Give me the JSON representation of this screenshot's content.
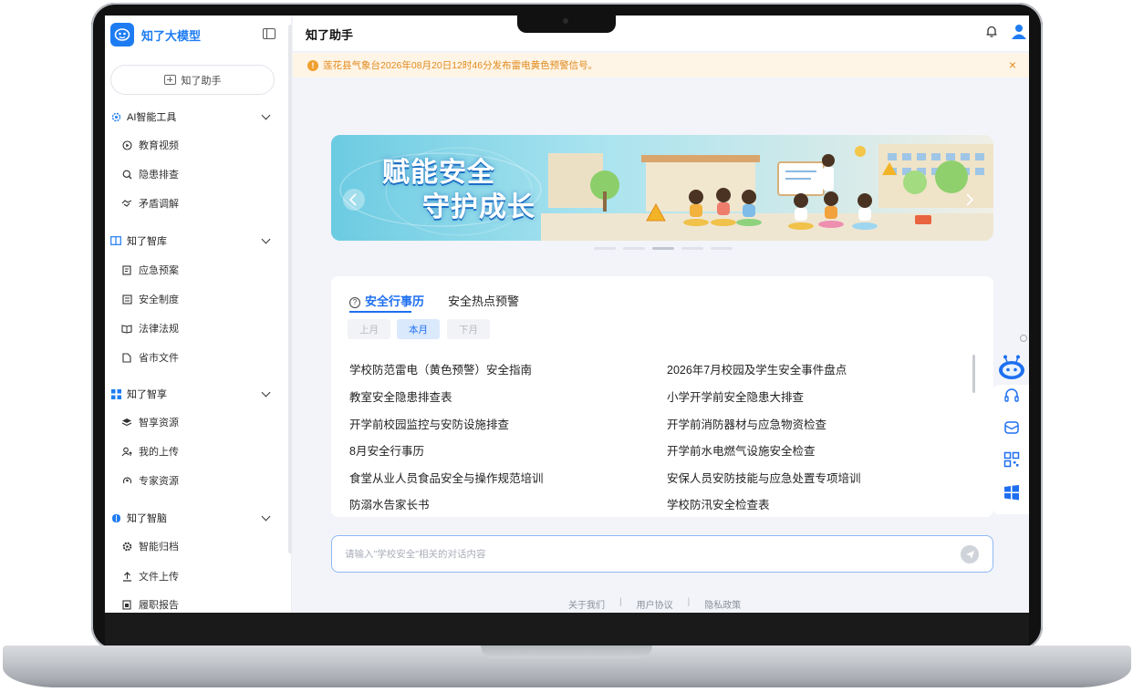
{
  "brand": {
    "name": "知了大模型"
  },
  "sidebar": {
    "new_chat_label": "知了助手",
    "groups": [
      {
        "label": "AI智能工具",
        "items": [
          {
            "label": "教育视频",
            "icon": "play-circle-icon"
          },
          {
            "label": "隐患排查",
            "icon": "search-icon"
          },
          {
            "label": "矛盾调解",
            "icon": "handshake-icon"
          }
        ]
      },
      {
        "label": "知了智库",
        "items": [
          {
            "label": "应急预案",
            "icon": "plan-icon"
          },
          {
            "label": "安全制度",
            "icon": "document-icon"
          },
          {
            "label": "法律法规",
            "icon": "book-icon"
          },
          {
            "label": "省市文件",
            "icon": "file-icon"
          }
        ]
      },
      {
        "label": "知了智享",
        "items": [
          {
            "label": "智享资源",
            "icon": "layers-icon"
          },
          {
            "label": "我的上传",
            "icon": "user-upload-icon"
          },
          {
            "label": "专家资源",
            "icon": "expert-icon"
          }
        ]
      },
      {
        "label": "知了智脑",
        "items": [
          {
            "label": "智能归档",
            "icon": "gear-icon"
          },
          {
            "label": "文件上传",
            "icon": "upload-icon"
          },
          {
            "label": "履职报告",
            "icon": "report-icon"
          }
        ]
      }
    ]
  },
  "header": {
    "title": "知了助手"
  },
  "alert": {
    "text": "莲花县气象台2026年08月20日12时46分发布雷电黄色预警信号。",
    "color": "#e08a1e"
  },
  "banner": {
    "title_line1": "赋能安全",
    "title_line2": "守护成长"
  },
  "events": {
    "tabs": [
      {
        "label": "安全行事历"
      },
      {
        "label": "安全热点预警"
      }
    ],
    "months": [
      {
        "label": "上月"
      },
      {
        "label": "本月"
      },
      {
        "label": "下月"
      }
    ],
    "items": [
      "学校防范雷电（黄色预警）安全指南",
      "2026年7月校园及学生安全事件盘点",
      "教室安全隐患排查表",
      "小学开学前安全隐患大排查",
      "开学前校园监控与安防设施排查",
      "开学前消防器材与应急物资检查",
      "8月安全行事历",
      "开学前水电燃气设施安全检查",
      "食堂从业人员食品安全与操作规范培训",
      "安保人员安防技能与应急处置专项培训",
      "防溺水告家长书",
      "学校防汛安全检查表"
    ]
  },
  "chat": {
    "placeholder": "请输入\"学校安全\"相关的对话内容"
  },
  "footer": {
    "links": [
      "关于我们",
      "用户协议",
      "隐私政策"
    ],
    "separator": "|"
  },
  "colors": {
    "accent": "#1e6ff0",
    "brand": "#1e7cf2"
  }
}
